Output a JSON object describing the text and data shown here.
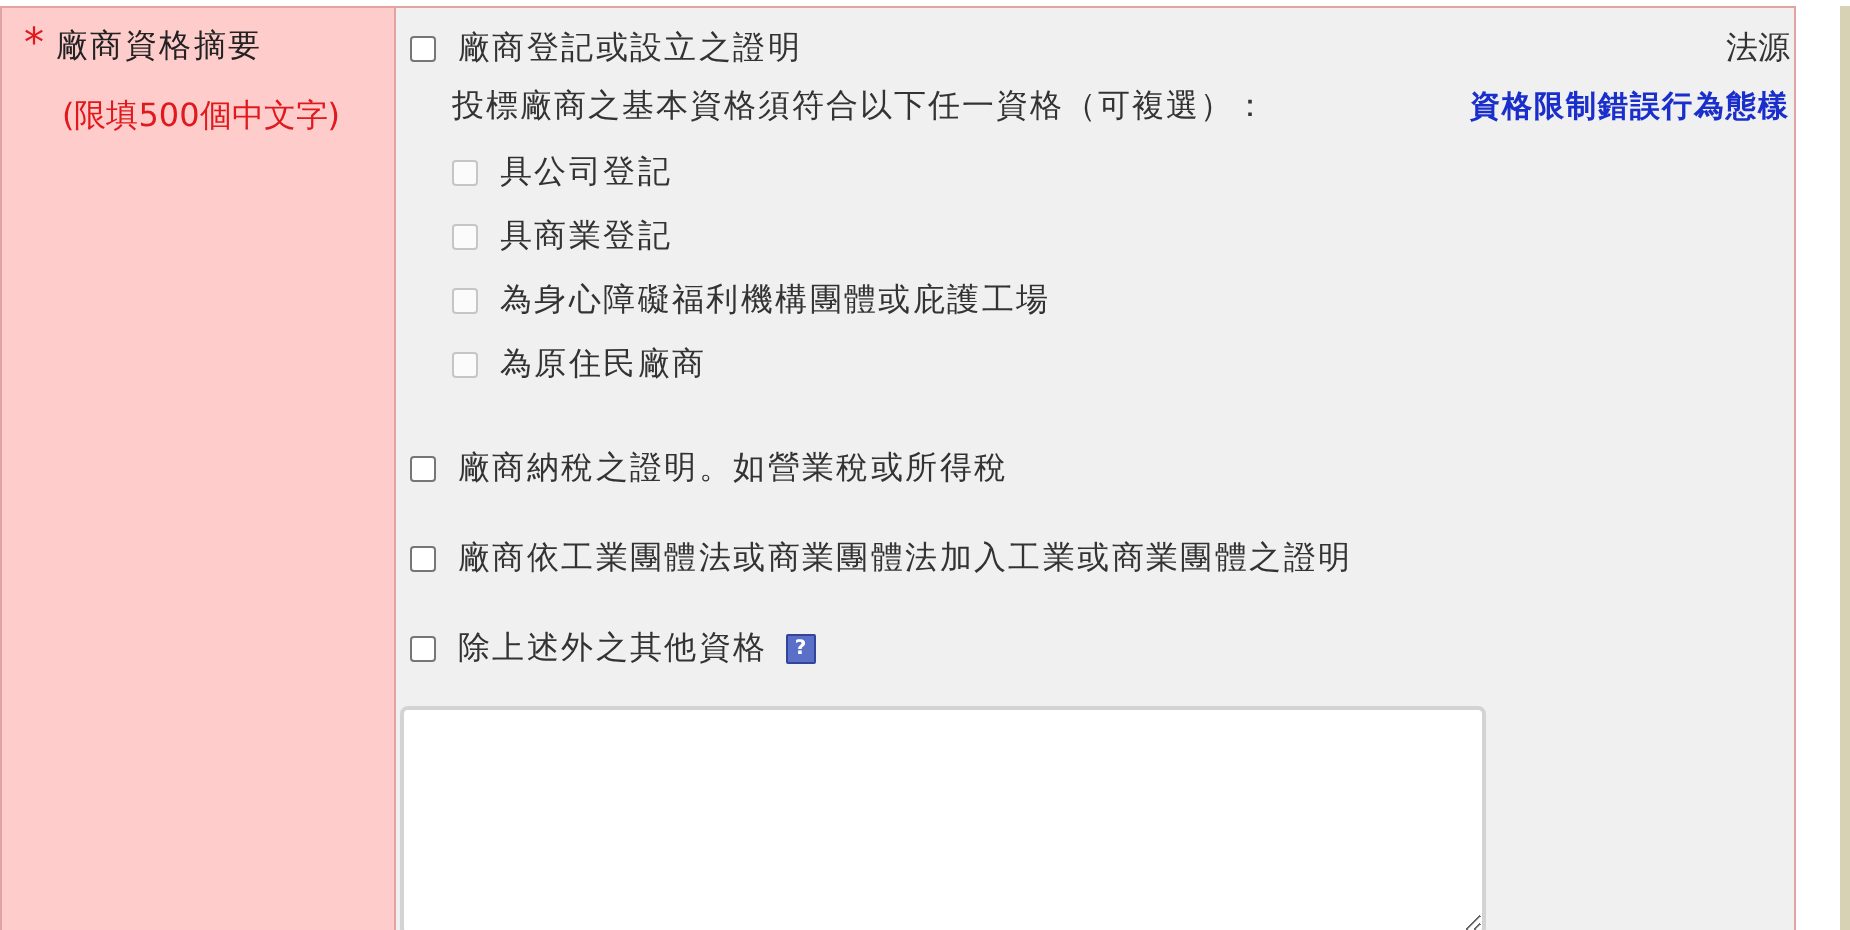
{
  "field": {
    "required_mark": "*",
    "label": "廠商資格摘要",
    "hint": "(限填500個中文字)"
  },
  "source_label": "法源",
  "link": "資格限制錯誤行為態樣",
  "options": [
    {
      "label": "廠商登記或設立之證明",
      "checked": false,
      "note": "投標廠商之基本資格須符合以下任一資格（可複選）：",
      "children": [
        {
          "label": "具公司登記",
          "checked": false,
          "disabled": true
        },
        {
          "label": "具商業登記",
          "checked": false,
          "disabled": true
        },
        {
          "label": "為身心障礙福利機構團體或庇護工場",
          "checked": false,
          "disabled": true
        },
        {
          "label": "為原住民廠商",
          "checked": false,
          "disabled": true
        }
      ]
    },
    {
      "label": "廠商納稅之證明。如營業稅或所得稅",
      "checked": false
    },
    {
      "label": "廠商依工業團體法或商業團體法加入工業或商業團體之證明",
      "checked": false
    },
    {
      "label": "除上述外之其他資格",
      "checked": false,
      "help": "?"
    }
  ]
}
